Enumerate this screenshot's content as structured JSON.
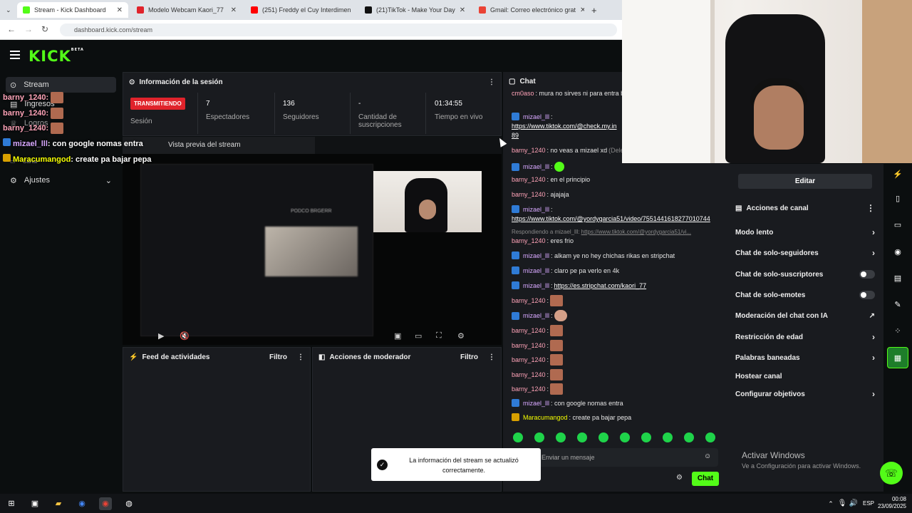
{
  "browser": {
    "tabs": [
      {
        "label": "Stream - Kick Dashboard",
        "color": "#53fc18"
      },
      {
        "label": "Modelo Webcam Kaori_77",
        "color": "#e0232b"
      },
      {
        "label": "(251) Freddy el Cuy Interdimen",
        "color": "#ff0000"
      },
      {
        "label": "(21)TikTok - Make Your Day",
        "color": "#111111"
      },
      {
        "label": "Gmail: Correo electrónico grat",
        "color": "#ea4335"
      }
    ],
    "url": "dashboard.kick.com/stream"
  },
  "kick": {
    "logo": "KICK",
    "logo_sup": "BETA"
  },
  "sidebar": {
    "items": [
      {
        "label": "Stream"
      },
      {
        "label": "Ingresos"
      },
      {
        "label": "Logros"
      },
      {
        "label": "Canal"
      },
      {
        "label": "Ajustes"
      }
    ]
  },
  "session": {
    "title": "Información de la sesión",
    "live_label": "TRANSMITIENDO",
    "session_label": "Sesión",
    "stats": [
      {
        "value": "7",
        "label": "Espectadores"
      },
      {
        "value": "136",
        "label": "Seguidores"
      },
      {
        "value": "-",
        "label": "Cantidad de suscripciones"
      },
      {
        "value": "01:34:55",
        "label": "Tiempo en vivo"
      }
    ]
  },
  "preview": {
    "title": "Vista previa del stream",
    "overlay_text": "PODCO BRGERR"
  },
  "activity": {
    "title": "Feed de actividades",
    "filter": "Filtro"
  },
  "mod": {
    "title": "Acciones de moderador",
    "filter": "Filtro"
  },
  "chat": {
    "title": "Chat",
    "messages": [
      {
        "user": "cm0aso",
        "text": ": mura no sirves ni para entra bajate el hilo y muestrame tu ano asi"
      },
      {
        "user": "mizael_lll",
        "text": ":",
        "link": "https://www.tiktok.com/@check.my.in",
        "link2": "89"
      },
      {
        "user": "barny_1240",
        "text": ": no veas a mizael xd",
        "extra": "(Dele"
      },
      {
        "user": "mizael_lll",
        "text": ":"
      },
      {
        "user": "barny_1240",
        "text": ": en el principio"
      },
      {
        "user": "barny_1240",
        "text": ": ajajaja"
      },
      {
        "user": "mizael_lll",
        "text": ":",
        "link": "https://www.tiktok.com/@yordygarcia51/video/7551441618277010744"
      },
      {
        "user": "",
        "text": "Respondiendo a mizael_lll:",
        "link": "https://www.tiktok.com/@yordygarcia51/vi..."
      },
      {
        "user": "barny_1240",
        "text": ": eres frio"
      },
      {
        "user": "mizael_lll",
        "text": ": alkam ye no hey chichas rikas en stripchat"
      },
      {
        "user": "mizael_lll",
        "text": ": claro pe pa verlo en 4k"
      },
      {
        "user": "mizael_lll",
        "text": ":",
        "link": "https://es.stripchat.com/kaori_77"
      },
      {
        "user": "barny_1240",
        "text": ":"
      },
      {
        "user": "mizael_lll",
        "text": ":"
      },
      {
        "user": "barny_1240",
        "text": ":"
      },
      {
        "user": "barny_1240",
        "text": ":"
      },
      {
        "user": "barny_1240",
        "text": ":"
      },
      {
        "user": "barny_1240",
        "text": ":"
      },
      {
        "user": "barny_1240",
        "text": ":"
      },
      {
        "user": "mizael_lll",
        "text": ": con google nomas entra"
      },
      {
        "user": "Maracumangod",
        "text": ": create pa bajar pepa"
      }
    ],
    "input_placeholder": "Enviar un mensaje",
    "send_label": "Chat"
  },
  "right_panel": {
    "edit_label": "Editar",
    "actions_title": "Acciones de canal",
    "items": [
      {
        "label": "Modo lento",
        "type": "chevron"
      },
      {
        "label": "Chat de solo-seguidores",
        "type": "chevron"
      },
      {
        "label": "Chat de solo-suscriptores",
        "type": "toggle"
      },
      {
        "label": "Chat de solo-emotes",
        "type": "toggle"
      },
      {
        "label": "Moderación del chat con IA",
        "type": "external"
      },
      {
        "label": "Restricción de edad",
        "type": "chevron"
      },
      {
        "label": "Palabras baneadas",
        "type": "chevron"
      },
      {
        "label": "Hostear canal",
        "type": "none"
      },
      {
        "label": "Configurar objetivos",
        "type": "chevron"
      }
    ]
  },
  "overlay_chat": [
    {
      "user": "barny_1240",
      "text": ":"
    },
    {
      "user": "barny_1240",
      "text": ":"
    },
    {
      "user": "barny_1240",
      "text": ":"
    },
    {
      "user": "mizael_lll",
      "text": ": con google nomas entra"
    },
    {
      "user": "Maracumangod",
      "text": ": create pa bajar pepa"
    }
  ],
  "toast": {
    "text": "La información del stream se actualizó correctamente."
  },
  "windows": {
    "activate_title": "Activar Windows",
    "activate_sub": "Ve a Configuración para activar Windows."
  },
  "taskbar": {
    "lang": "ESP",
    "time": "00:08",
    "date": "23/09/2025"
  }
}
